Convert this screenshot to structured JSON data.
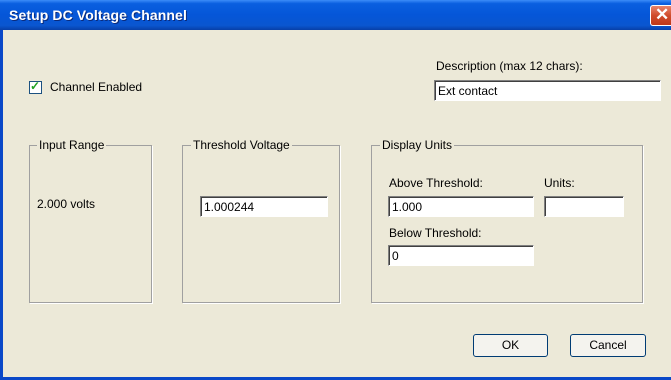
{
  "window": {
    "title": "Setup DC Voltage Channel"
  },
  "channel": {
    "enabled_label": "Channel Enabled",
    "enabled": true
  },
  "description": {
    "label": "Description (max 12 chars):",
    "value": "Ext contact"
  },
  "input_range": {
    "legend": "Input Range",
    "value": "2.000 volts"
  },
  "threshold": {
    "legend": "Threshold Voltage",
    "value": "1.000244"
  },
  "display_units": {
    "legend": "Display Units",
    "above_label": "Above Threshold:",
    "above_value": "1.000",
    "units_label": "Units:",
    "units_value": "",
    "below_label": "Below Threshold:",
    "below_value": "0"
  },
  "buttons": {
    "ok": "OK",
    "cancel": "Cancel"
  }
}
